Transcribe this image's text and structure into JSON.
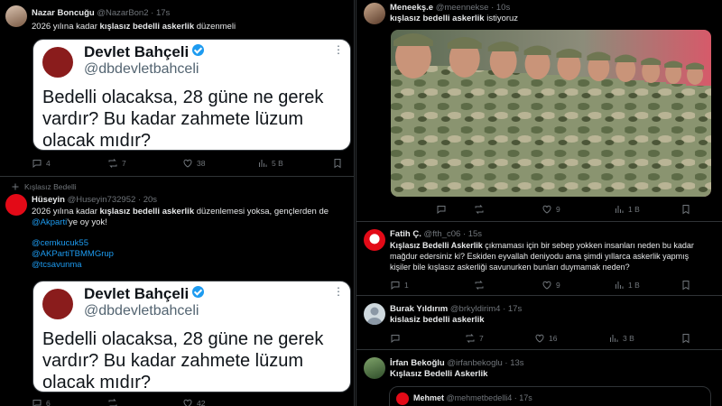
{
  "left": {
    "tweet1": {
      "name": "Nazar Boncuğu",
      "handle": "@NazarBon2 · 17s",
      "text_pre": "2026 yılına kadar ",
      "text_bold": "kışlasız bedelli askerlik",
      "text_post": " düzenmeli",
      "card": {
        "name": "Devlet Bahçeli",
        "handle": "@dbdevletbahceli",
        "text": "Bedelli olacaksa, 28 güne ne gerek vardır? Bu kadar zahmete lüzum olacak mıdır?"
      },
      "actions": {
        "reply": "4",
        "retweet": "7",
        "like": "38",
        "views": "5 B"
      }
    },
    "tweet2": {
      "context": "Kışlasız Bedelli",
      "name": "Hüseyin",
      "handle": "@Huseyin732952 · 20s",
      "text_pre": "2026 yılına kadar ",
      "text_bold": "kışlasız bedelli askerlik",
      "text_post": " düzenlemesi yoksa, gençlerden de ",
      "mention1": "@Akparti",
      "text_after_mention": "'ye oy yok!",
      "mention2": "@cemkucuk55",
      "mention3": "@AKPartiTBMMGrup",
      "mention4": "@tcsavunma",
      "card": {
        "name": "Devlet Bahçeli",
        "handle": "@dbdevletbahceli",
        "text": "Bedelli olacaksa, 28 güne ne gerek vardır? Bu kadar zahmete lüzum olacak mıdır?"
      },
      "actions": {
        "reply": "6",
        "retweet": "",
        "like": "42",
        "views": ""
      }
    }
  },
  "right": {
    "tweet1": {
      "name": "Meneekş.e",
      "handle": "@meennekse · 10s",
      "text_bold": "kışlasız bedelli askerlik",
      "text_post": " istiyoruz",
      "actions": {
        "reply": "",
        "retweet": "",
        "like": "9",
        "views": "1 B"
      }
    },
    "tweet2": {
      "name": "Fatih Ç.",
      "handle": "@fth_c06 · 15s",
      "text_bold": "Kışlasız Bedelli Askerlik",
      "text_post": " çıkmaması için bir sebep yokken insanları neden bu kadar mağdur edersiniz ki? Eskiden eyvallah deniyodu ama şimdi yıllarca askerlik yapmış kişiler bile kışlasız askerliği savunurken bunları duymamak neden?",
      "actions": {
        "reply": "1",
        "retweet": "",
        "like": "9",
        "views": "1 B"
      }
    },
    "tweet3": {
      "name": "Burak Yıldırım",
      "handle": "@brkyldirim4 · 17s",
      "text_bold": "kislasiz bedelli askerlik",
      "actions": {
        "reply": "",
        "retweet": "7",
        "like": "16",
        "views": "3 B"
      }
    },
    "tweet4": {
      "name": "İrfan Bekoğlu",
      "handle": "@irfanbekoglu · 13s",
      "text_bold": "Kışlasız Bedelli Askerlik",
      "quote_name": "Mehmet",
      "quote_handle": "@mehmetbedelli4 · 17s"
    }
  },
  "colors": {
    "accent": "#1d9bf0",
    "background": "#000000",
    "muted": "#71767b",
    "border": "#2f3336"
  },
  "icons": [
    "reply-icon",
    "retweet-icon",
    "like-icon",
    "views-icon",
    "bookmark-icon",
    "verified-icon",
    "more-icon",
    "pin-icon"
  ]
}
